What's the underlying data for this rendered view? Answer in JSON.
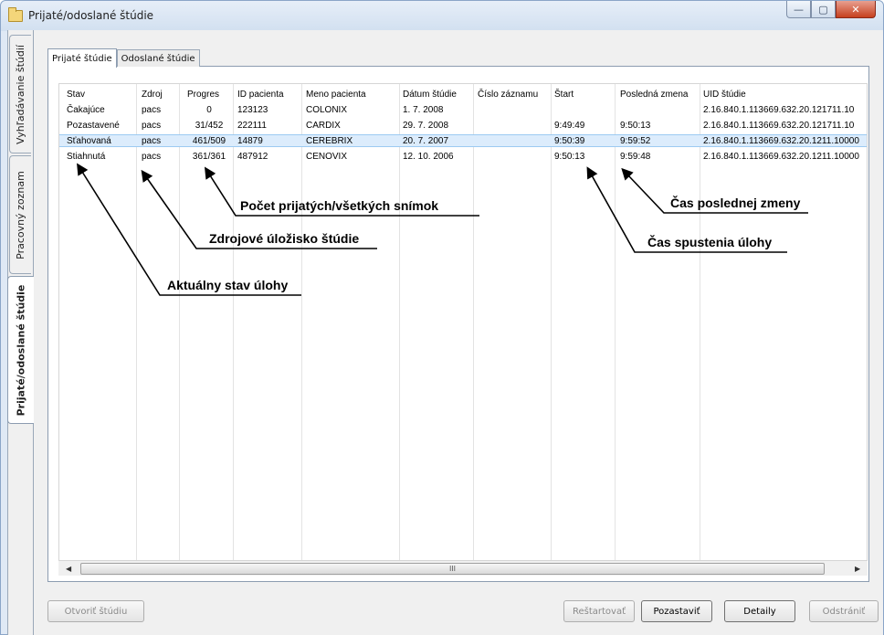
{
  "window": {
    "title": "Prijaté/odoslané štúdie",
    "controls": {
      "minimize": "—",
      "maximize": "▢",
      "close": "✕"
    }
  },
  "side_tabs": [
    {
      "label": "Vyhľadávanie štúdií"
    },
    {
      "label": "Pracovný zoznam"
    },
    {
      "label": "Prijaté/odoslané štúdie",
      "active": true
    }
  ],
  "tabs": [
    {
      "label": "Prijaté štúdie",
      "active": true
    },
    {
      "label": "Odoslané štúdie"
    }
  ],
  "table": {
    "columns": [
      "Stav",
      "Zdroj",
      "Progres",
      "ID pacienta",
      "Meno pacienta",
      "Dátum štúdie",
      "Číslo záznamu",
      "Štart",
      "Posledná zmena",
      "UID štúdie"
    ],
    "rows": [
      [
        "Čakajúce",
        "pacs",
        "0",
        "123123",
        "COLONIX",
        "1. 7. 2008",
        "",
        "",
        "",
        "2.16.840.1.113669.632.20.121711.10"
      ],
      [
        "Pozastavené",
        "pacs",
        "31/452",
        "222111",
        "CARDIX",
        "29. 7. 2008",
        "",
        "9:49:49",
        "9:50:13",
        "2.16.840.1.113669.632.20.121711.10"
      ],
      [
        "Sťahovaná",
        "pacs",
        "461/509",
        "14879",
        "CEREBRIX",
        "20. 7. 2007",
        "",
        "9:50:39",
        "9:59:52",
        "2.16.840.1.113669.632.20.1211.10000"
      ],
      [
        "Stiahnutá",
        "pacs",
        "361/361",
        "487912",
        "CENOVIX",
        "12. 10. 2006",
        "",
        "9:50:13",
        "9:59:48",
        "2.16.840.1.113669.632.20.1211.10000"
      ]
    ],
    "selected_row": 2,
    "scrollbar": {
      "left": "◀",
      "right": "▶",
      "grip": "III"
    }
  },
  "annotations": {
    "progress": "Počet prijatých/všetkých snímok",
    "source": "Zdrojové úložisko štúdie",
    "status": "Aktuálny stav úlohy",
    "last_change": "Čas poslednej zmeny",
    "start": "Čas spustenia úlohy"
  },
  "buttons": {
    "open": "Otvoriť štúdiu",
    "restart": "Reštartovať",
    "pause": "Pozastaviť",
    "details": "Detaily",
    "remove": "Odstrániť"
  }
}
